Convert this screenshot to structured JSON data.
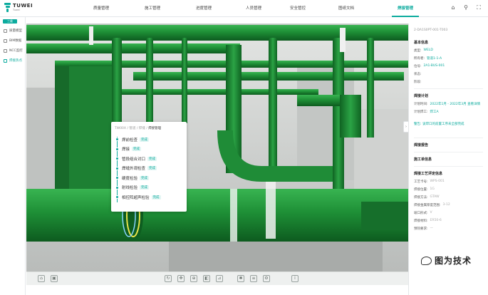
{
  "app": {
    "brand": "TUWEI",
    "brand_sub": "Tuwei"
  },
  "nav": [
    {
      "label": "质量管理"
    },
    {
      "label": "施工管理"
    },
    {
      "label": "进度管理"
    },
    {
      "label": "人员管理"
    },
    {
      "label": "安全管控"
    },
    {
      "label": "图纸文档"
    },
    {
      "label": "焊接管理"
    }
  ],
  "top_icons": [
    "home-icon",
    "search-icon",
    "fullscreen-icon"
  ],
  "sidebar": {
    "header": "三维",
    "items": [
      {
        "label": "质量模型",
        "icon": "cube-icon"
      },
      {
        "label": "BIM数据",
        "icon": "layers-icon"
      },
      {
        "label": "NCC监控",
        "icon": "monitor-icon"
      },
      {
        "label": "焊接热点",
        "icon": "weld-icon"
      }
    ]
  },
  "popup": {
    "breadcrumb": "TW00X / 管道 / 焊缝 /",
    "current": "焊接管理",
    "steps": [
      {
        "label": "焊前检查",
        "status": "完成"
      },
      {
        "label": "焊接",
        "status": "完成"
      },
      {
        "label": "管段组合对口",
        "status": "完成"
      },
      {
        "label": "焊缝外观检查",
        "status": "完成"
      },
      {
        "label": "硬度检验",
        "status": "完成"
      },
      {
        "label": "射线检验",
        "status": "完成"
      },
      {
        "label": "相控阵超声检验",
        "status": "完成"
      }
    ]
  },
  "right_panel": {
    "code": "2-DA1S0PT-001-T003",
    "basic_info": "基本信息",
    "basic_rows": [
      {
        "k": "类型:",
        "v": "WELD"
      },
      {
        "k": "所有者:",
        "v": "管道1-1-A"
      },
      {
        "k": "位号:",
        "v": "2A1-BUS-001"
      },
      {
        "k": "状态:",
        "v": ""
      },
      {
        "k": "阶段:",
        "v": ""
      }
    ],
    "weld_plan": "焊接计划",
    "plan_rows": [
      {
        "k": "计划时间:",
        "v": "2022年1月 - 2022年3月 查看详情"
      },
      {
        "k": "计划焊工:",
        "v": "焊工A"
      }
    ],
    "warning": "警告: 该焊口的前置工序未全部完成",
    "weld_report": "焊接报告",
    "construction_info": "施工单信息",
    "process_info": "焊接工艺评定信息",
    "process_rows": [
      {
        "k": "工艺卡号:",
        "v": "WPS-001"
      },
      {
        "k": "焊接位置:",
        "v": "1G"
      },
      {
        "k": "焊接方法:",
        "v": "GTAW"
      },
      {
        "k": "焊接金属厚度范围:",
        "v": "3-12"
      },
      {
        "k": "坡口形式:",
        "v": "V"
      },
      {
        "k": "焊接材料:",
        "v": "ER50-6"
      },
      {
        "k": "预热要求:",
        "v": "—"
      }
    ]
  },
  "toolbar": [
    "home-view-icon",
    "cube-view-icon",
    "rotate-icon",
    "pan-icon",
    "zoom-icon",
    "section-icon",
    "measure-icon",
    "explode-icon",
    "layers-icon",
    "settings-icon",
    "info-icon"
  ],
  "watermark": "图为技术"
}
